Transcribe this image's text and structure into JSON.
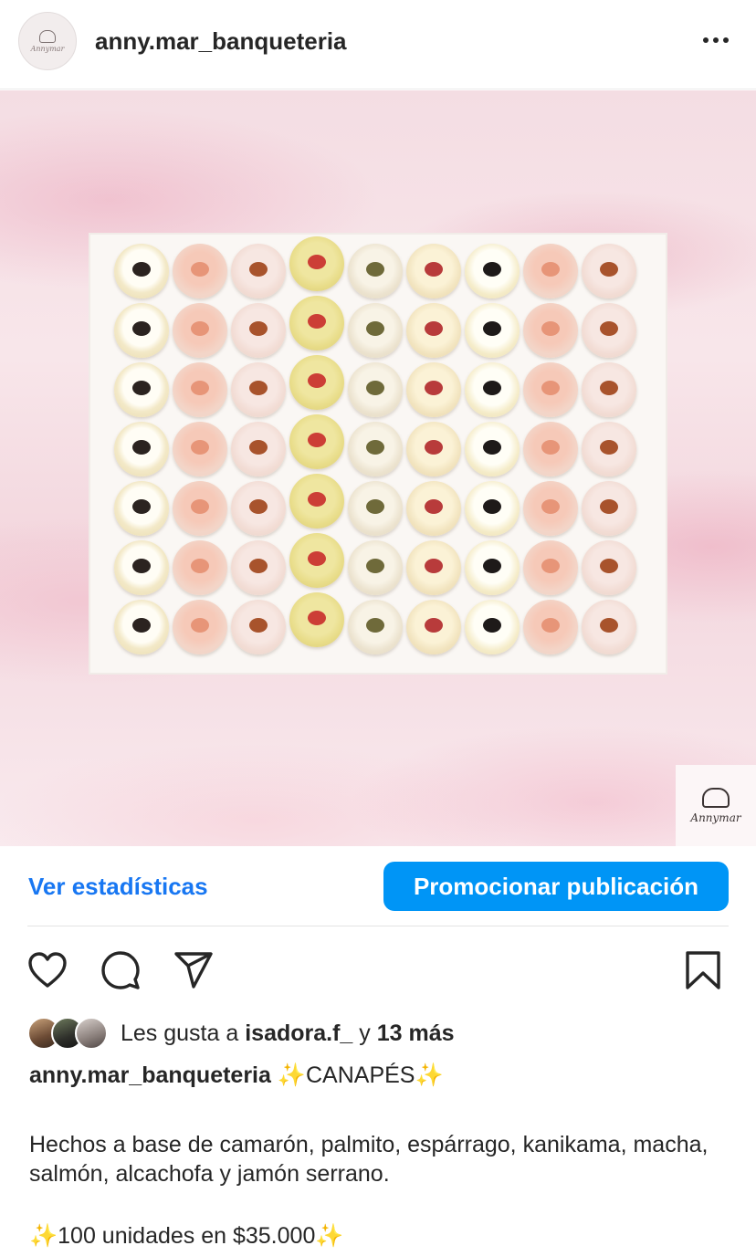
{
  "header": {
    "username": "anny.mar_banqueteria",
    "avatar_brand": "Annymar",
    "more_icon": "more-horizontal-icon"
  },
  "post": {
    "watermark_brand": "Annymar",
    "canape_colors": {
      "egg_olive": "#2b2320",
      "shrimp": "#e79578",
      "ham_almond": "#a8532c",
      "salmon_avocado": "#cc3e36",
      "caper": "#6f6a3a",
      "jamon": "#b83b3b"
    }
  },
  "actions": {
    "stats_label": "Ver estadísticas",
    "promote_label": "Promocionar publicación",
    "accent": "#0095f6",
    "icons": [
      "heart-icon",
      "comment-icon",
      "share-icon",
      "bookmark-icon"
    ]
  },
  "likes": {
    "prefix": "Les gusta a",
    "user": "isadora.f_",
    "connector": "y",
    "count": "13 más"
  },
  "caption": {
    "username": "anny.mar_banqueteria",
    "sparkle": "✨",
    "title": "CANAPÉS",
    "body": " Hechos a base de camarón, palmito, espárrago, kanikama, macha, salmón, alcachofa y jamón serrano.",
    "price": "100 unidades en $35.000"
  }
}
